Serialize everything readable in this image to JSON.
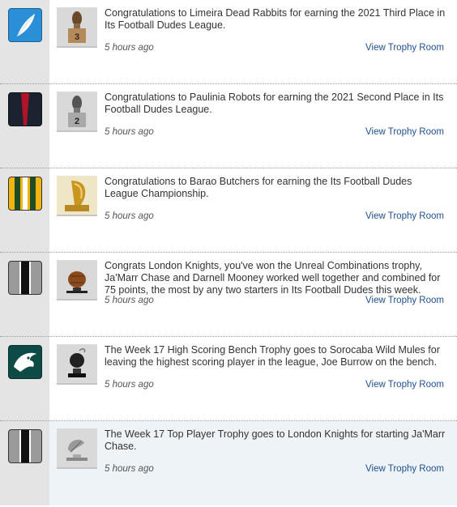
{
  "feed": {
    "items": [
      {
        "team_logo": "white-feather-on-blue-logo",
        "trophy_icon": "third-place-trophy-icon",
        "message": "Congratulations to Limeira Dead Rabbits for earning the 2021 Third Place in Its Football Dudes League.",
        "time": "5 hours ago",
        "link": "View Trophy Room"
      },
      {
        "team_logo": "navy-red-stripe-logo",
        "trophy_icon": "second-place-trophy-icon",
        "message": "Congratulations to Paulinia Robots for earning the 2021 Second Place in Its Football Dudes League.",
        "time": "5 hours ago",
        "link": "View Trophy Room"
      },
      {
        "team_logo": "green-gold-stripes-logo",
        "trophy_icon": "championship-trophy-icon",
        "message": "Congratulations to Barao Butchers for earning the Its Football Dudes League Championship.",
        "time": "5 hours ago",
        "link": "View Trophy Room"
      },
      {
        "team_logo": "grey-black-stripe-logo",
        "trophy_icon": "football-trophy-icon",
        "message": "Congrats London Knights, you've won the Unreal Combinations trophy, Ja'Marr Chase and Darnell Mooney worked well together and combined for 75 points, the most by any two starters in Its Football Dudes this week.",
        "time": "5 hours ago",
        "link": "View Trophy Room"
      },
      {
        "team_logo": "eagle-head-logo",
        "trophy_icon": "bomb-trophy-icon",
        "message": "The Week 17 High Scoring Bench Trophy goes to Sorocaba Wild Mules for leaving the highest scoring player in the league, Joe Burrow on the bench.",
        "time": "5 hours ago",
        "link": "View Trophy Room"
      },
      {
        "team_logo": "grey-black-stripe-logo",
        "trophy_icon": "top-player-trophy-icon",
        "message": "The Week 17 Top Player Trophy goes to London Knights for starting Ja'Marr Chase.",
        "time": "5 hours ago",
        "link": "View Trophy Room"
      }
    ]
  },
  "colors": {
    "gutter": "#e4e4e4",
    "link": "#1f4f8f",
    "highlight_row": "#eef3f7"
  }
}
